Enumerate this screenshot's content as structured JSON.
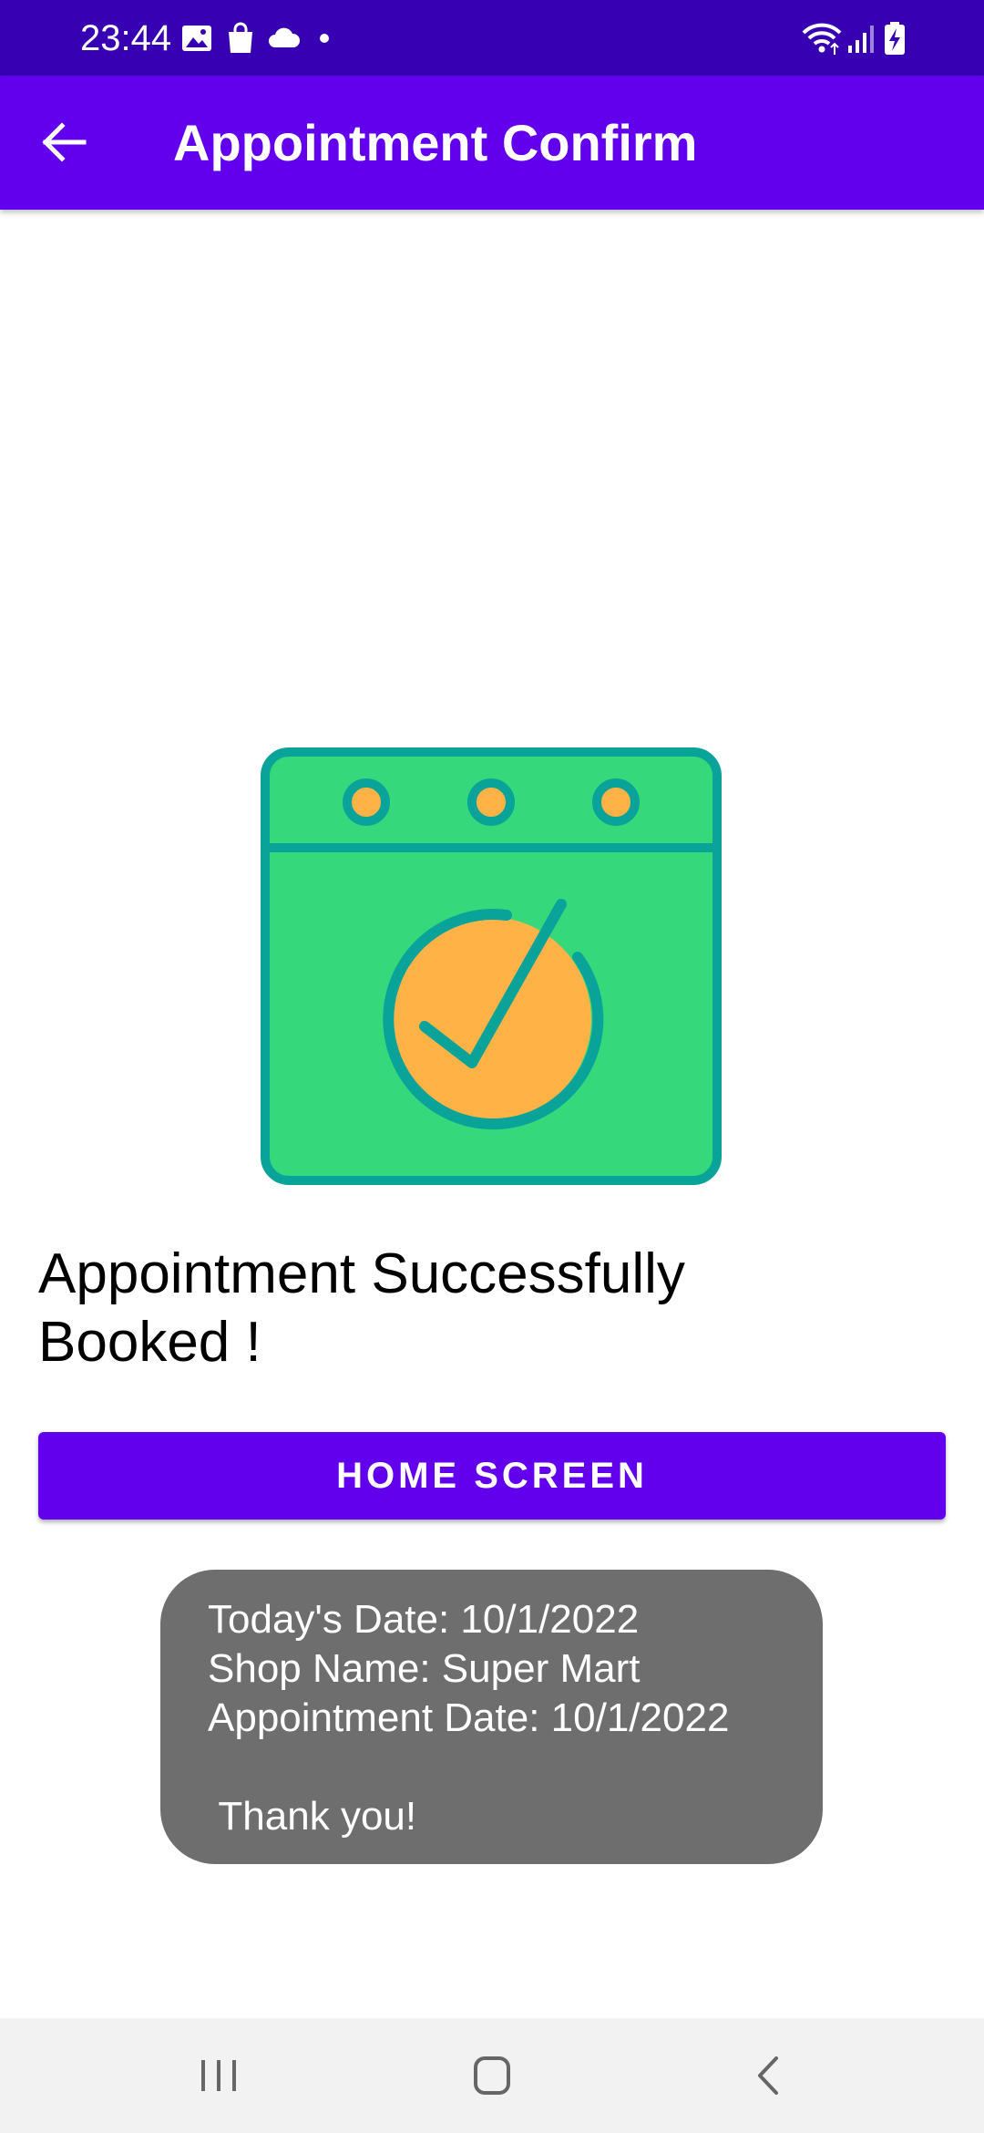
{
  "status_bar": {
    "time": "23:44",
    "left_icons": [
      "image-icon",
      "shopping-bag-icon",
      "cloud-icon",
      "dot-icon"
    ],
    "right_icons": [
      "wifi-icon",
      "signal-icon",
      "battery-charging-icon"
    ]
  },
  "app_bar": {
    "title": "Appointment Confirm",
    "back_icon": "arrow-back-icon"
  },
  "illustration": {
    "icon": "calendar-check-icon",
    "colors": {
      "body": "#35d87a",
      "outline": "#0aa39a",
      "accent": "#ffb347"
    }
  },
  "main": {
    "success_line1": "Appointment Successfully",
    "success_line2": "Booked !",
    "home_button_label": "HOME SCREEN"
  },
  "toast": {
    "line1": "Today's Date: 10/1/2022",
    "line2": "Shop Name: Super Mart",
    "line3": "Appointment Date: 10/1/2022",
    "line4": " Thank you!"
  },
  "nav_bar": {
    "icons": [
      "recent-apps-icon",
      "home-icon",
      "back-icon"
    ]
  },
  "colors": {
    "status_bar": "#3700b3",
    "primary": "#6200ee",
    "toast_bg": "#6e6e6e",
    "nav_bg": "#f2f2f2"
  }
}
